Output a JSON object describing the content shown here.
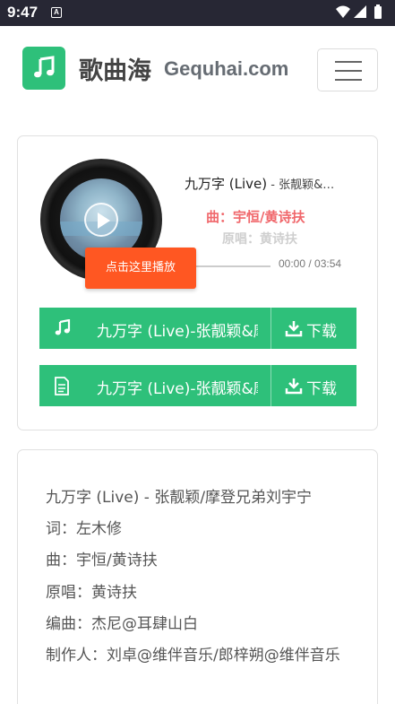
{
  "status_bar": {
    "time": "9:47",
    "notification": "A"
  },
  "header": {
    "brand_cn": "歌曲海",
    "brand_en": "Gequhai.com",
    "logo_icon": "music-note-icon",
    "menu_icon": "hamburger-menu-icon"
  },
  "player": {
    "title": "九万字 (Live)",
    "artist": " - 张靓颖&…",
    "composer": "曲：宇恒/黄诗扶",
    "original": "原唱：黄诗扶",
    "time": "00:00 / 03:54",
    "tip": "点击这里播放",
    "progress": 0
  },
  "downloads": [
    {
      "icon": "music-note-icon",
      "name": "九万字 (Live)-张靓颖&摩登兄弟刘宇宁",
      "button": "下载"
    },
    {
      "icon": "document-icon",
      "name": "九万字 (Live)-张靓颖&摩登兄弟刘宇宁",
      "button": "下载"
    }
  ],
  "lyrics": [
    "九万字 (Live) - 张靓颖/摩登兄弟刘宇宁",
    "词：左木修",
    "曲：宇恒/黄诗扶",
    "原唱：黄诗扶",
    "编曲：杰尼@耳肆山白",
    "制作人：刘卓@维伴音乐/郎梓朔@维伴音乐"
  ],
  "colors": {
    "accent": "#2ec07a",
    "tip": "#ff5722",
    "composer": "#f0676b",
    "status_bar": "#272734"
  }
}
